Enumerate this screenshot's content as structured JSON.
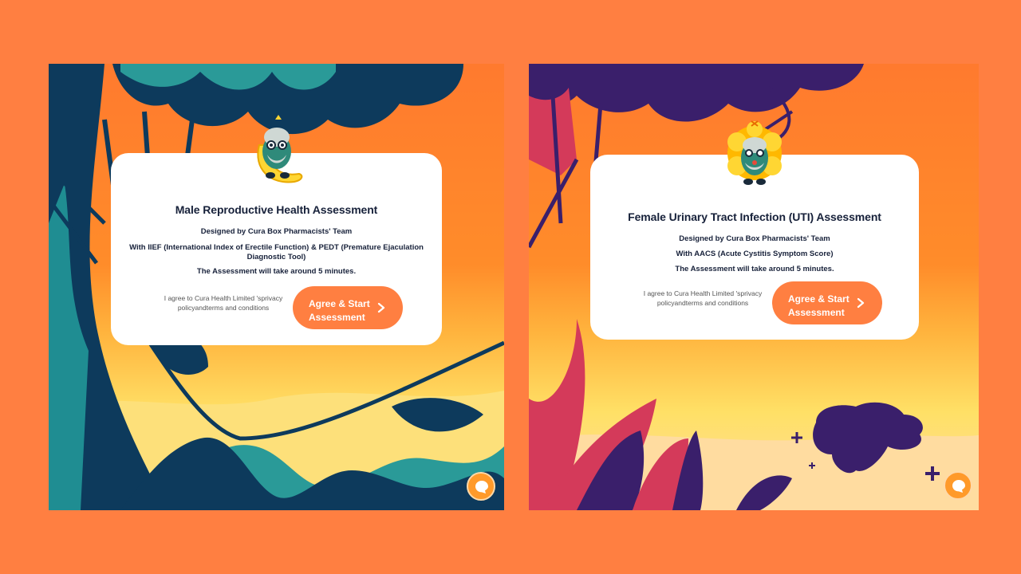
{
  "colors": {
    "background": "#ff7f41",
    "accent": "#ff7f41",
    "card": "#ffffff",
    "text": "#17213a",
    "chat": "#ff9a2a"
  },
  "assessments": [
    {
      "title": "Male Reproductive Health Assessment",
      "designed_by": "Designed by Cura Box Pharmacists' Team",
      "tool_line": "With IIEF (International Index of Erectile Function) & PEDT (Premature Ejaculation Diagnostic Tool)",
      "duration": "The Assessment will take around 5 minutes.",
      "agree_text": "I agree to Cura Health Limited 'sprivacy policyandterms and conditions",
      "button_label": "Agree & Start Assessment",
      "chat_icon": "chat-bubble-icon",
      "mascot_icon": "banana-mascot-icon"
    },
    {
      "title": "Female Urinary Tract Infection (UTI) Assessment",
      "designed_by": "Designed by Cura Box Pharmacists' Team",
      "tool_line": "With AACS (Acute Cystitis Symptom Score)",
      "duration": "The Assessment will take around 5 minutes.",
      "agree_text": "I agree to Cura Health Limited 'sprivacy policyandterms and conditions",
      "button_label": "Agree & Start Assessment",
      "chat_icon": "chat-bubble-icon",
      "mascot_icon": "flower-mascot-icon"
    }
  ]
}
